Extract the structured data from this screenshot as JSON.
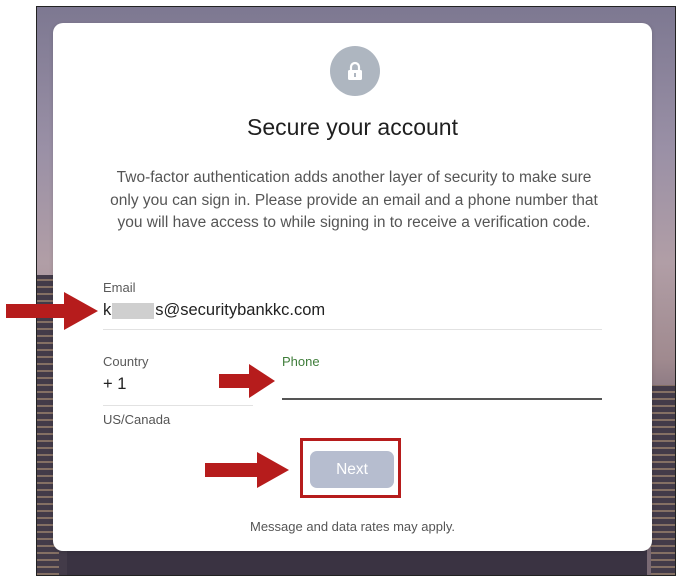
{
  "card": {
    "icon": "lock-icon",
    "title": "Secure your account",
    "description": "Two-factor authentication adds another layer of security to make sure only you can sign in. Please provide an email and a phone number that you will have access to while signing in to receive a verification code."
  },
  "email": {
    "label": "Email",
    "value_prefix": "k",
    "value_suffix": "s@securitybankkc.com"
  },
  "country": {
    "label": "Country",
    "code": "+ 1",
    "region": "US/Canada"
  },
  "phone": {
    "label": "Phone",
    "value": ""
  },
  "next_button": {
    "label": "Next"
  },
  "footnote": "Message and data rates may apply.",
  "colors": {
    "phone_label": "#3f7d3a",
    "button_disabled": "#b6bdcf",
    "annotation_red": "#b61c1c"
  }
}
